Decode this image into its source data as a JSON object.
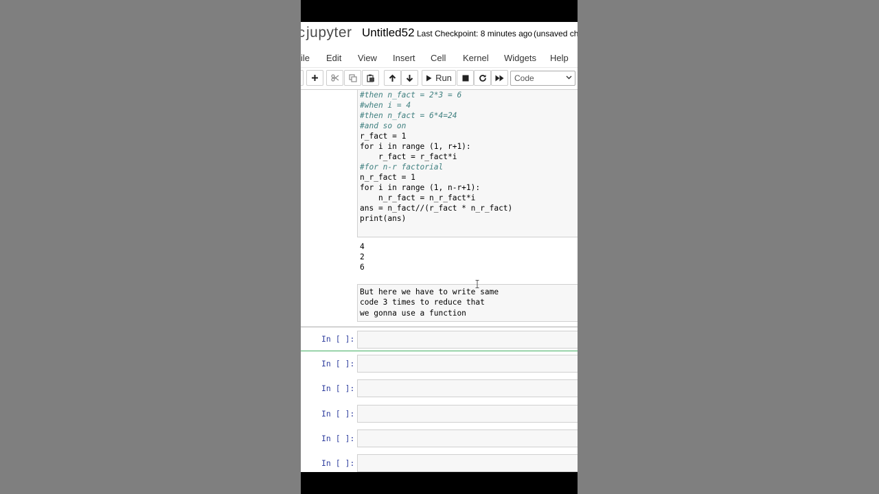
{
  "header": {
    "logo_mark": "c",
    "logo_text": "jupyter",
    "notebook_name": "Untitled52",
    "checkpoint": "Last Checkpoint: 8 minutes ago",
    "unsaved": "(unsaved cha"
  },
  "menu": [
    "ile",
    "Edit",
    "View",
    "Insert",
    "Cell",
    "Kernel",
    "Widgets",
    "Help"
  ],
  "toolbar": {
    "run_label": "Run",
    "cell_type": "Code"
  },
  "code_cell": {
    "lines": [
      "#then n_fact = 2*3 = 6",
      "#when i = 4",
      "#then n_fact = 6*4=24",
      "#and so on",
      "r_fact = 1",
      "for i in range (1, r+1):",
      "    r_fact = r_fact*i",
      "#for n-r factorial",
      "n_r_fact = 1",
      "for i in range (1, n-r+1):",
      "    n_r_fact = n_r_fact*i",
      "ans = n_fact//(r_fact * n_r_fact)",
      "print(ans)"
    ]
  },
  "output": [
    "4",
    "2",
    "6"
  ],
  "markdown": [
    "But here we have to write same",
    "code 3 times to reduce that",
    "we gonna use a function"
  ],
  "empty_cells": [
    {
      "prompt": "In [ ]:"
    },
    {
      "prompt": "In [ ]:"
    },
    {
      "prompt": "In [ ]:"
    },
    {
      "prompt": "In [ ]:"
    },
    {
      "prompt": "In [ ]:"
    },
    {
      "prompt": "In [ ]:"
    }
  ],
  "colors": {
    "comment": "#408080",
    "keyword": "#008000",
    "operator": "#aa22ff",
    "prompt": "#303f9f",
    "selected_border": "#3fae5f"
  }
}
